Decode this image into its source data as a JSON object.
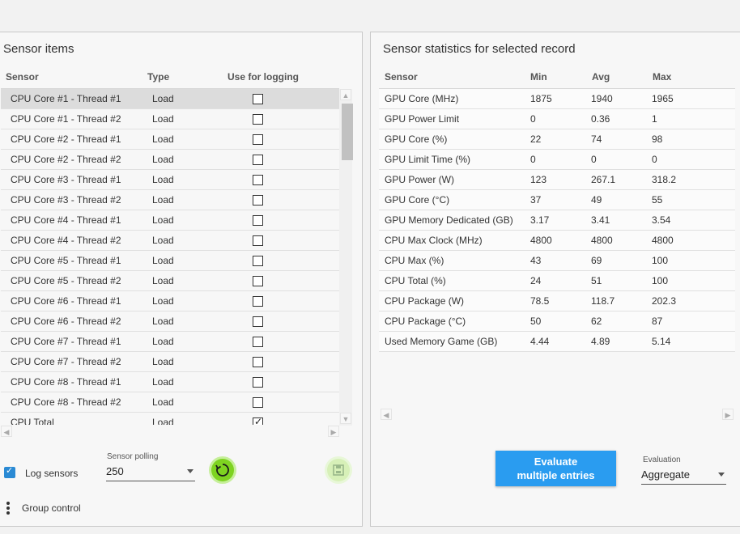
{
  "left": {
    "title": "Sensor items",
    "headers": {
      "sensor": "Sensor",
      "type": "Type",
      "logging": "Use for logging"
    },
    "rows": [
      {
        "sensor": "CPU Core #1 - Thread #1",
        "type": "Load",
        "checked": false,
        "selected": true
      },
      {
        "sensor": "CPU Core #1 - Thread #2",
        "type": "Load",
        "checked": false
      },
      {
        "sensor": "CPU Core #2 - Thread #1",
        "type": "Load",
        "checked": false
      },
      {
        "sensor": "CPU Core #2 - Thread #2",
        "type": "Load",
        "checked": false
      },
      {
        "sensor": "CPU Core #3 - Thread #1",
        "type": "Load",
        "checked": false
      },
      {
        "sensor": "CPU Core #3 - Thread #2",
        "type": "Load",
        "checked": false
      },
      {
        "sensor": "CPU Core #4 - Thread #1",
        "type": "Load",
        "checked": false
      },
      {
        "sensor": "CPU Core #4 - Thread #2",
        "type": "Load",
        "checked": false
      },
      {
        "sensor": "CPU Core #5 - Thread #1",
        "type": "Load",
        "checked": false
      },
      {
        "sensor": "CPU Core #5 - Thread #2",
        "type": "Load",
        "checked": false
      },
      {
        "sensor": "CPU Core #6 - Thread #1",
        "type": "Load",
        "checked": false
      },
      {
        "sensor": "CPU Core #6 - Thread #2",
        "type": "Load",
        "checked": false
      },
      {
        "sensor": "CPU Core #7 - Thread #1",
        "type": "Load",
        "checked": false
      },
      {
        "sensor": "CPU Core #7 - Thread #2",
        "type": "Load",
        "checked": false
      },
      {
        "sensor": "CPU Core #8 - Thread #1",
        "type": "Load",
        "checked": false
      },
      {
        "sensor": "CPU Core #8 - Thread #2",
        "type": "Load",
        "checked": false
      },
      {
        "sensor": "CPU Total",
        "type": "Load",
        "checked": true
      }
    ],
    "log_sensors_label": "Log sensors",
    "log_sensors_checked": true,
    "polling_label": "Sensor polling",
    "polling_value": "250",
    "group_control_label": "Group control"
  },
  "right": {
    "title": "Sensor statistics for selected record",
    "headers": {
      "sensor": "Sensor",
      "min": "Min",
      "avg": "Avg",
      "max": "Max"
    },
    "rows": [
      {
        "sensor": "GPU Core (MHz)",
        "min": "1875",
        "avg": "1940",
        "max": "1965"
      },
      {
        "sensor": "GPU Power Limit",
        "min": "0",
        "avg": "0.36",
        "max": "1"
      },
      {
        "sensor": "GPU Core (%)",
        "min": "22",
        "avg": "74",
        "max": "98"
      },
      {
        "sensor": "GPU Limit Time (%)",
        "min": "0",
        "avg": "0",
        "max": "0"
      },
      {
        "sensor": "GPU Power (W)",
        "min": "123",
        "avg": "267.1",
        "max": "318.2"
      },
      {
        "sensor": "GPU Core (°C)",
        "min": "37",
        "avg": "49",
        "max": "55"
      },
      {
        "sensor": "GPU Memory Dedicated (GB)",
        "min": "3.17",
        "avg": "3.41",
        "max": "3.54"
      },
      {
        "sensor": "CPU Max Clock (MHz)",
        "min": "4800",
        "avg": "4800",
        "max": "4800"
      },
      {
        "sensor": "CPU Max (%)",
        "min": "43",
        "avg": "69",
        "max": "100"
      },
      {
        "sensor": "CPU Total (%)",
        "min": "24",
        "avg": "51",
        "max": "100"
      },
      {
        "sensor": "CPU Package (W)",
        "min": "78.5",
        "avg": "118.7",
        "max": "202.3"
      },
      {
        "sensor": "CPU Package (°C)",
        "min": "50",
        "avg": "62",
        "max": "87"
      },
      {
        "sensor": "Used Memory Game (GB)",
        "min": "4.44",
        "avg": "4.89",
        "max": "5.14"
      }
    ],
    "evaluate_line1": "Evaluate",
    "evaluate_line2": "multiple entries",
    "evaluation_label": "Evaluation",
    "evaluation_value": "Aggregate"
  },
  "colors": {
    "accent": "#2a9cf0",
    "refresh": "#7ed321",
    "save_disabled": "#d7f0b8",
    "checkbox": "#2a8ad4"
  }
}
